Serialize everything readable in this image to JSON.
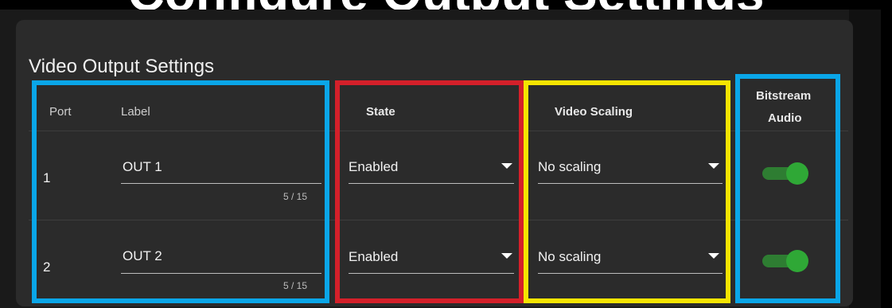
{
  "panel": {
    "title": "Video Output Settings"
  },
  "columns": {
    "port": "Port",
    "label": "Label",
    "state": "State",
    "video_scaling": "Video Scaling",
    "bitstream_audio_line1": "Bitstream",
    "bitstream_audio_line2": "Audio"
  },
  "rows": [
    {
      "port": "1",
      "label": "OUT 1",
      "counter": "5 / 15",
      "state": "Enabled",
      "scaling": "No scaling",
      "bitstream_audio": true
    },
    {
      "port": "2",
      "label": "OUT 2",
      "counter": "5 / 15",
      "state": "Enabled",
      "scaling": "No scaling",
      "bitstream_audio": true
    }
  ],
  "highlight_colors": {
    "blue": "#0aa6e8",
    "red": "#d4202a",
    "yellow": "#f5e400"
  },
  "toggle_on_color": "#2fa836"
}
